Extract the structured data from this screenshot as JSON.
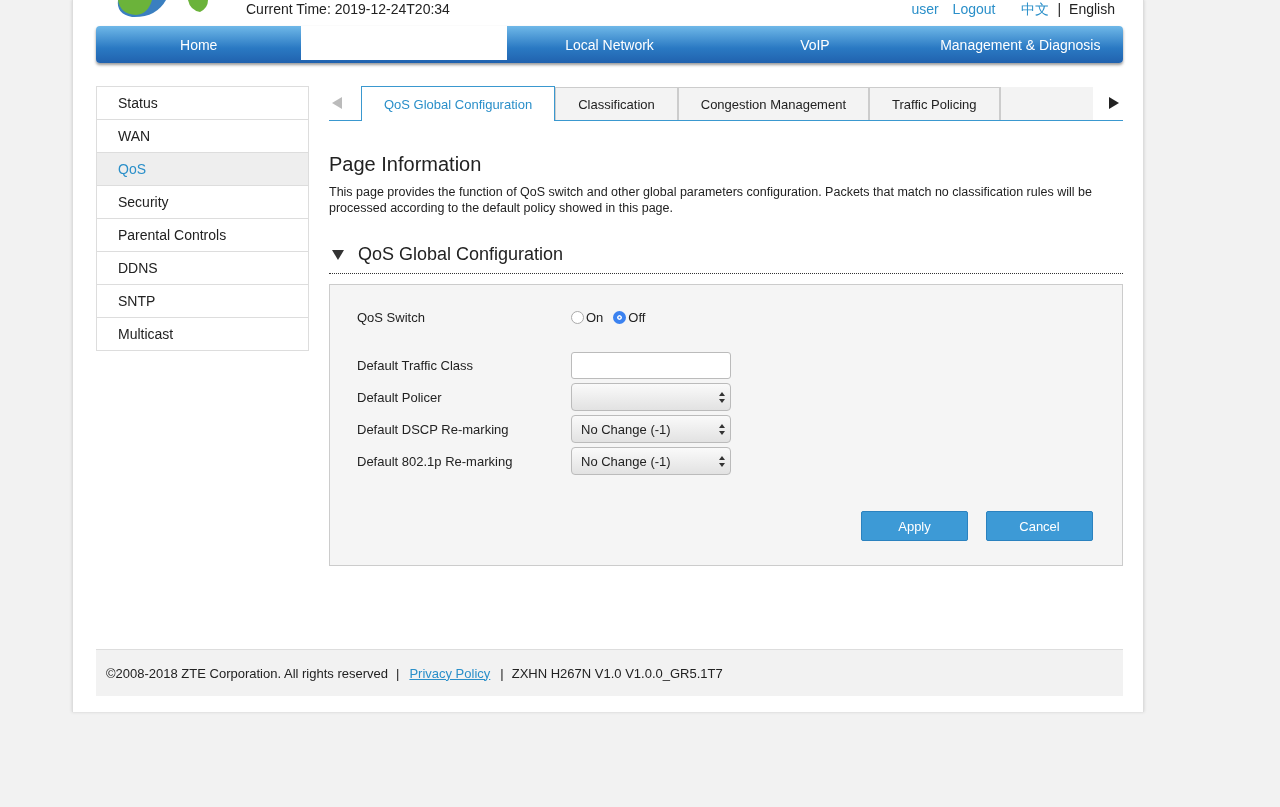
{
  "header": {
    "current_time": "Current Time: 2019-12-24T20:34",
    "user": "user",
    "logout": "Logout",
    "languages": [
      {
        "label": "中文",
        "selected": false
      },
      {
        "label": "English",
        "selected": true
      }
    ],
    "separator": "|"
  },
  "nav": [
    {
      "label": "Home",
      "selected": false
    },
    {
      "selected": true
    },
    {
      "label": "Local Network",
      "selected": false
    },
    {
      "label": "VoIP",
      "selected": false
    },
    {
      "label": "Management & Diagnosis",
      "selected": false
    }
  ],
  "sidebar": {
    "items": [
      {
        "label": "Status",
        "selected": false
      },
      {
        "label": "WAN",
        "selected": false
      },
      {
        "label": "QoS",
        "selected": true
      },
      {
        "label": "Security",
        "selected": false
      },
      {
        "label": "Parental Controls",
        "selected": false
      },
      {
        "label": "DDNS",
        "selected": false
      },
      {
        "label": "SNTP",
        "selected": false
      },
      {
        "label": "Multicast",
        "selected": false
      }
    ]
  },
  "tabs": [
    {
      "label": "QoS Global Configuration",
      "selected": true
    },
    {
      "label": "Classification",
      "selected": false
    },
    {
      "label": "Congestion Management",
      "selected": false
    },
    {
      "label": "Traffic Policing",
      "selected": false
    }
  ],
  "page_info": {
    "title": "Page Information",
    "text": "This page provides the function of QoS switch and other global parameters configuration. Packets that match no classification rules will be processed according to the default policy showed in this page."
  },
  "section": {
    "title": "QoS Global Configuration",
    "expanded": true,
    "fields": [
      {
        "kind": "radio",
        "label": "QoS Switch",
        "options": [
          {
            "label": "On",
            "selected": false
          },
          {
            "label": "Off",
            "selected": true
          }
        ]
      },
      {
        "kind": "text",
        "label": "Default Traffic Class"
      },
      {
        "kind": "select",
        "label": "Default Policer"
      },
      {
        "kind": "select",
        "label": "Default DSCP Re-marking",
        "value": "No Change (-1)"
      },
      {
        "kind": "select",
        "label": "Default 802.1p Re-marking",
        "value": "No Change (-1)"
      }
    ],
    "buttons": [
      "Apply",
      "Cancel"
    ]
  },
  "footer": {
    "copyright": "©2008-2018 ZTE Corporation. All rights reserved",
    "privacy": "Privacy Policy",
    "version": "ZXHN H267N V1.0 V1.0.0_GR5.1T7",
    "separator": "|"
  }
}
